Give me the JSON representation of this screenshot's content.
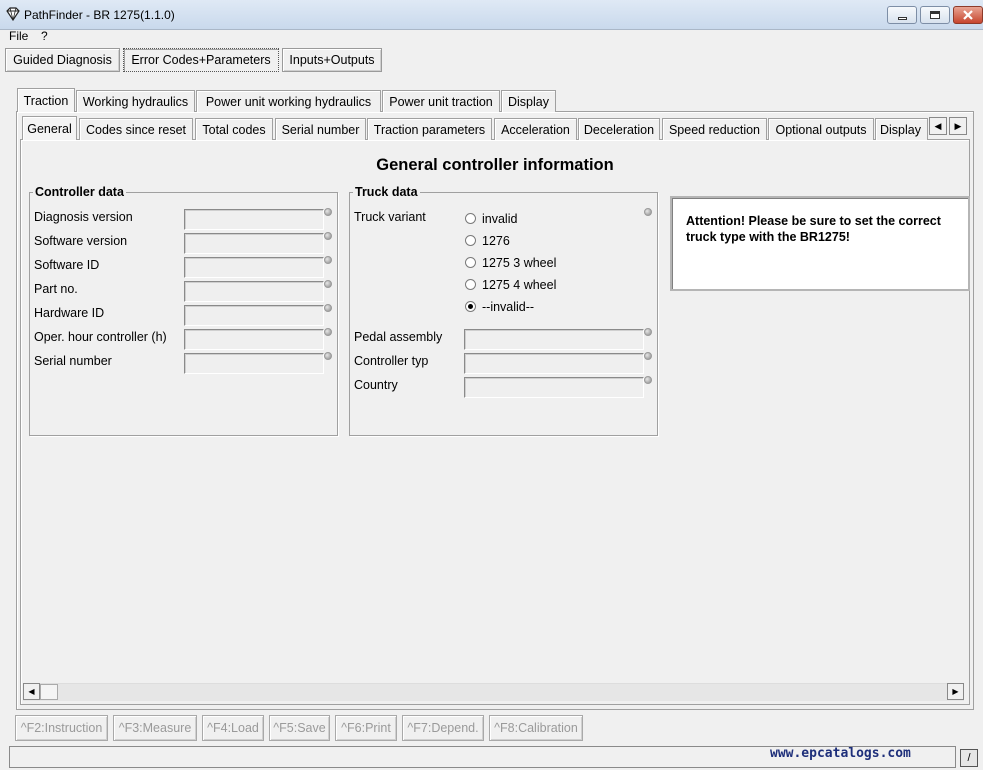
{
  "window": {
    "title": "PathFinder - BR 1275(1.1.0)"
  },
  "menu": {
    "items": [
      "File",
      "?"
    ]
  },
  "top_buttons": [
    "Guided Diagnosis",
    "Error Codes+Parameters",
    "Inputs+Outputs"
  ],
  "top_tabs": [
    "Traction",
    "Working hydraulics",
    "Power unit working hydraulics",
    "Power unit traction",
    "Display"
  ],
  "sub_tabs": [
    "General",
    "Codes since reset",
    "Total codes",
    "Serial number",
    "Traction parameters",
    "Acceleration",
    "Deceleration",
    "Speed reduction",
    "Optional outputs",
    "Display"
  ],
  "main": {
    "heading": "General controller information",
    "controller_group": {
      "title": "Controller data",
      "fields": [
        {
          "label": "Diagnosis version",
          "value": ""
        },
        {
          "label": "Software version",
          "value": ""
        },
        {
          "label": "Software ID",
          "value": ""
        },
        {
          "label": "Part no.",
          "value": ""
        },
        {
          "label": "Hardware ID",
          "value": ""
        },
        {
          "label": "Oper. hour controller (h)",
          "value": ""
        },
        {
          "label": "Serial number",
          "value": ""
        }
      ]
    },
    "truck_group": {
      "title": "Truck data",
      "variant_label": "Truck variant",
      "variants": [
        "invalid",
        "1276",
        "1275 3 wheel",
        "1275 4 wheel",
        "--invalid--"
      ],
      "selected_variant": "--invalid--",
      "fields": [
        {
          "label": "Pedal assembly",
          "value": ""
        },
        {
          "label": "Controller typ",
          "value": ""
        },
        {
          "label": "Country",
          "value": ""
        }
      ]
    },
    "attention": "Attention! Please be sure to set the correct truck type with the BR1275!"
  },
  "function_keys": [
    "^F2:Instruction",
    "^F3:Measure",
    "^F4:Load",
    "^F5:Save",
    "^F6:Print",
    "^F7:Depend.",
    "^F8:Calibration"
  ],
  "status": {
    "watermark": "www.epcatalogs.com",
    "corner_button": "/"
  }
}
